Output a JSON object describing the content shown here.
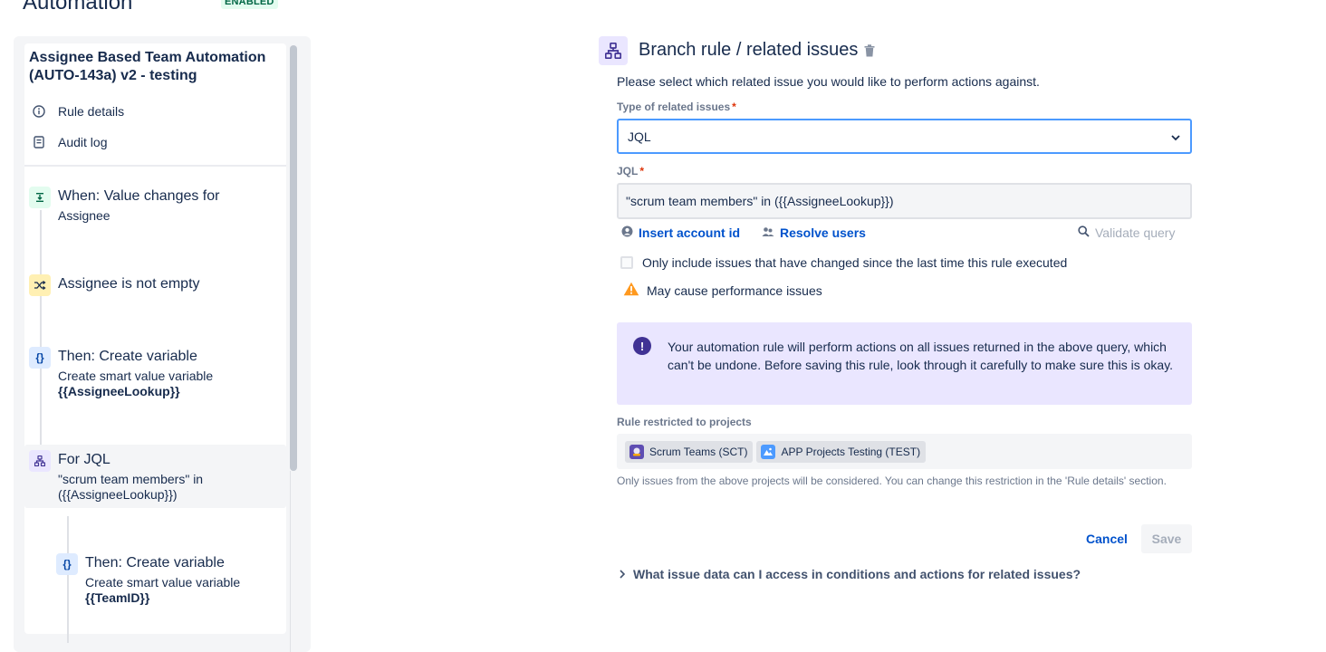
{
  "header": {
    "title": "Automation",
    "status_badge": "ENABLED"
  },
  "sidebar": {
    "rule_title": "Assignee Based Team Automation (AUTO-143a) v2 - testing",
    "links": [
      {
        "label": "Rule details",
        "icon": "info-icon"
      },
      {
        "label": "Audit log",
        "icon": "document-icon"
      }
    ],
    "steps": [
      {
        "title": "When: Value changes for",
        "sub": "Assignee",
        "icon": "trigger-icon"
      },
      {
        "title": "Assignee is not empty",
        "sub": "",
        "icon": "condition-icon"
      },
      {
        "title": "Then: Create variable",
        "sub": "Create smart value variable",
        "sub_bold": "{{AssigneeLookup}}",
        "icon": "variable-icon"
      },
      {
        "title": "For JQL",
        "sub": "\"scrum team members\" in ({{AssigneeLookup}})",
        "icon": "branch-icon"
      },
      {
        "title": "Then: Create variable",
        "sub": "Create smart value variable",
        "sub_bold": "{{TeamID}}",
        "icon": "variable-icon"
      }
    ]
  },
  "panel": {
    "title": "Branch rule / related issues",
    "description": "Please select which related issue you would like to perform actions against.",
    "type_label": "Type of related issues",
    "type_value": "JQL",
    "jql_label": "JQL",
    "jql_value": "\"scrum team members\" in ({{AssigneeLookup}})",
    "insert_account_id": "Insert account id",
    "resolve_users": "Resolve users",
    "validate_query": "Validate query",
    "checkbox_label": "Only include issues that have changed since the last time this rule executed",
    "warning": "May cause performance issues",
    "info_message": "Your automation rule will perform actions on all issues returned in the above query, which can't be undone. Before saving this rule, look through it carefully to make sure this is okay.",
    "projects_label": "Rule restricted to projects",
    "projects": [
      {
        "name": "Scrum Teams (SCT)"
      },
      {
        "name": "APP Projects Testing (TEST)"
      }
    ],
    "helper_text": "Only issues from the above projects will be considered. You can change this restriction in the 'Rule details' section.",
    "cancel": "Cancel",
    "save": "Save",
    "expander": "What issue data can I access in conditions and actions for related issues?"
  },
  "colors": {
    "accent": "#0052cc",
    "focus": "#4c9aff",
    "info_bg": "#eae6ff",
    "warning": "#ff991f"
  }
}
